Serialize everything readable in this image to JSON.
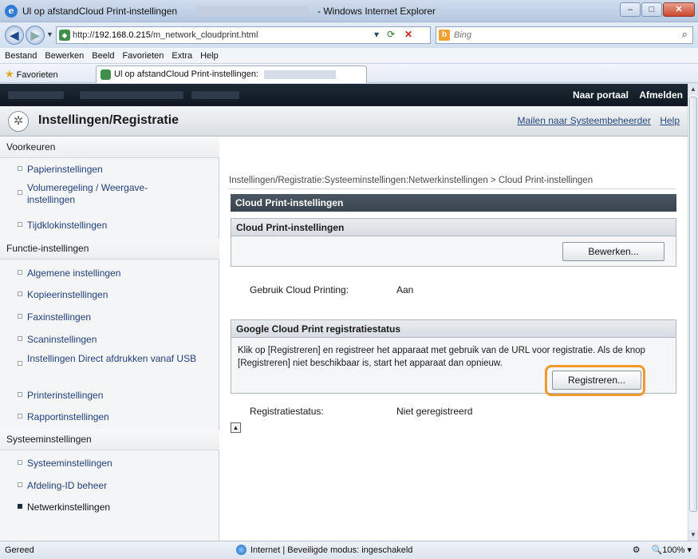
{
  "window": {
    "title_left": "Ul op afstandCloud Print-instellingen",
    "title_right": "- Windows Internet Explorer",
    "btn_minimize": "–",
    "btn_maximize": "□",
    "btn_close": "✕"
  },
  "address": {
    "url_prefix": "http://",
    "url_host": "192.168.0.215",
    "url_path": "/m_network_cloudprint.html",
    "search_placeholder": "Bing"
  },
  "menu": [
    "Bestand",
    "Bewerken",
    "Beeld",
    "Favorieten",
    "Extra",
    "Help"
  ],
  "favorites": {
    "label": "Favorieten",
    "tab_label": "Ul op afstandCloud Print-instellingen:"
  },
  "portal": {
    "link_portal": "Naar portaal",
    "link_logout": "Afmelden"
  },
  "header": {
    "title": "Instellingen/Registratie",
    "link_mail": "Mailen naar Systeembeheerder",
    "link_help": "Help"
  },
  "sidebar": {
    "sections": [
      {
        "label": "Voorkeuren"
      },
      {
        "label": "Functie-instellingen"
      },
      {
        "label": "Systeeminstellingen"
      }
    ],
    "items": [
      {
        "label": "Papierinstellingen"
      },
      {
        "label": "Volumeregeling / Weergave-instellingen"
      },
      {
        "label": "Tijdklokinstellingen"
      },
      {
        "label": "Algemene instellingen"
      },
      {
        "label": "Kopieerinstellingen"
      },
      {
        "label": "Faxinstellingen"
      },
      {
        "label": "Scaninstellingen"
      },
      {
        "label": "Instellingen Direct afdrukken vanaf USB"
      },
      {
        "label": "Printerinstellingen"
      },
      {
        "label": "Rapportinstellingen"
      },
      {
        "label": "Systeeminstellingen"
      },
      {
        "label": "Afdeling-ID beheer"
      },
      {
        "label": "Netwerkinstellingen"
      }
    ]
  },
  "main": {
    "breadcrumb": "Instellingen/Registratie:Systeeminstellingen:Netwerkinstellingen > Cloud Print-instellingen",
    "section_title": "Cloud Print-instellingen",
    "box1_title": "Cloud Print-instellingen",
    "edit_button": "Bewerken...",
    "cloud_label": "Gebruik Cloud Printing:",
    "cloud_value": "Aan",
    "box2_title": "Google Cloud Print registratiestatus",
    "box2_text": "Klik op [Registreren] en registreer het apparaat met gebruik van de URL voor registratie. Als de knop [Registreren] niet beschikbaar is, start het apparaat dan opnieuw.",
    "register_button": "Registreren...",
    "status_label": "Registratiestatus:",
    "status_value": "Niet geregistreerd",
    "highlight_color": "#f09a2e"
  },
  "statusbar": {
    "left": "Gereed",
    "mid": "Internet | Beveiligde modus: ingeschakeld",
    "zoom": "100%",
    "zoom_icon": "🔍",
    "security_icon": "⚙"
  }
}
